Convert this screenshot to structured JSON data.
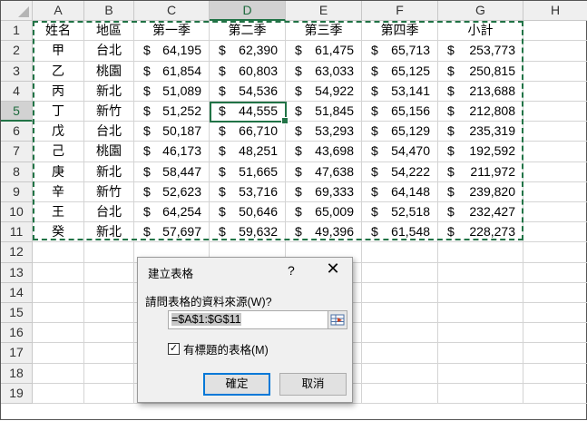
{
  "columns": [
    "A",
    "B",
    "C",
    "D",
    "E",
    "F",
    "G",
    "H"
  ],
  "selected_column": "D",
  "selected_row": 5,
  "row_count": 19,
  "headers": [
    "姓名",
    "地區",
    "第一季",
    "第二季",
    "第三季",
    "第四季",
    "小計"
  ],
  "rows": [
    [
      "甲",
      "台北",
      "64,195",
      "62,390",
      "61,475",
      "65,713",
      "253,773"
    ],
    [
      "乙",
      "桃園",
      "61,854",
      "60,803",
      "63,033",
      "65,125",
      "250,815"
    ],
    [
      "丙",
      "新北",
      "51,089",
      "54,536",
      "54,922",
      "53,141",
      "213,688"
    ],
    [
      "丁",
      "新竹",
      "51,252",
      "44,555",
      "51,845",
      "65,156",
      "212,808"
    ],
    [
      "戊",
      "台北",
      "50,187",
      "66,710",
      "53,293",
      "65,129",
      "235,319"
    ],
    [
      "己",
      "桃園",
      "46,173",
      "48,251",
      "43,698",
      "54,470",
      "192,592"
    ],
    [
      "庚",
      "新北",
      "58,447",
      "51,665",
      "47,638",
      "54,222",
      "211,972"
    ],
    [
      "辛",
      "新竹",
      "52,623",
      "53,716",
      "69,333",
      "64,148",
      "239,820"
    ],
    [
      "王",
      "台北",
      "64,254",
      "50,646",
      "65,009",
      "52,518",
      "232,427"
    ],
    [
      "癸",
      "新北",
      "57,697",
      "59,632",
      "49,396",
      "61,548",
      "228,273"
    ]
  ],
  "currency_symbol": "$",
  "dialog": {
    "title": "建立表格",
    "help": "?",
    "close": "✕",
    "prompt": "請問表格的資料來源(W)?",
    "range_value": "=$A$1:$G$11",
    "checkbox_label": "有標題的表格(M)",
    "checkbox_checked": true,
    "ok": "確定",
    "cancel": "取消"
  },
  "colors": {
    "accent": "#217346",
    "focus": "#0078d7"
  }
}
